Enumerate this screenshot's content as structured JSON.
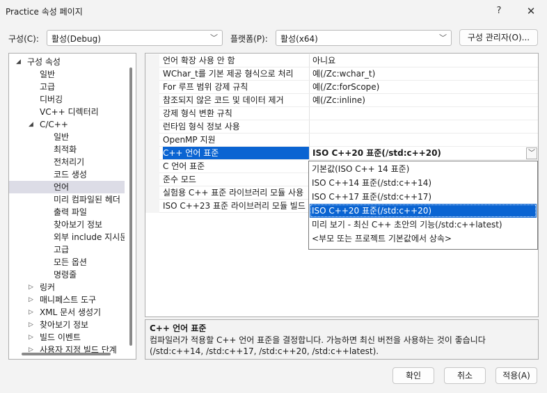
{
  "window": {
    "title": "Practice 속성 페이지",
    "help_label": "?",
    "close_label": "✕"
  },
  "config": {
    "configuration_label": "구성(C):",
    "configuration_value": "활성(Debug)",
    "platform_label": "플랫폼(P):",
    "platform_value": "활성(x64)",
    "manager_button": "구성 관리자(O)..."
  },
  "tree": {
    "items": [
      {
        "label": "구성 속성",
        "twisty": "◢"
      },
      {
        "label": "일반"
      },
      {
        "label": "고급"
      },
      {
        "label": "디버깅"
      },
      {
        "label": "VC++ 디렉터리"
      },
      {
        "label": "C/C++",
        "twisty": "◢"
      },
      {
        "label": "일반"
      },
      {
        "label": "최적화"
      },
      {
        "label": "전처리기"
      },
      {
        "label": "코드 생성"
      },
      {
        "label": "언어"
      },
      {
        "label": "미리 컴파일된 헤더"
      },
      {
        "label": "출력 파일"
      },
      {
        "label": "찾아보기 정보"
      },
      {
        "label": "외부 include 지시문"
      },
      {
        "label": "고급"
      },
      {
        "label": "모든 옵션"
      },
      {
        "label": "명령줄"
      },
      {
        "label": "링커",
        "twisty": "▷"
      },
      {
        "label": "매니페스트 도구",
        "twisty": "▷"
      },
      {
        "label": "XML 문서 생성기",
        "twisty": "▷"
      },
      {
        "label": "찾아보기 정보",
        "twisty": "▷"
      },
      {
        "label": "빌드 이벤트",
        "twisty": "▷"
      },
      {
        "label": "사용자 지정 빌드 단계",
        "twisty": "▷"
      }
    ]
  },
  "properties": {
    "rows": [
      {
        "name": "언어 확장 사용 안 함",
        "value": "아니요"
      },
      {
        "name": "WChar_t를 기본 제공 형식으로 처리",
        "value": "예(/Zc:wchar_t)"
      },
      {
        "name": "For 루프 범위 강제 규칙",
        "value": "예(/Zc:forScope)"
      },
      {
        "name": "참조되지 않은 코드 및 데이터 제거",
        "value": "예(/Zc:inline)"
      },
      {
        "name": "강제 형식 변환 규칙",
        "value": ""
      },
      {
        "name": "런타임 형식 정보 사용",
        "value": ""
      },
      {
        "name": "OpenMP 지원",
        "value": ""
      },
      {
        "name": "C++ 언어 표준",
        "value": "ISO C++20 표준(/std:c++20)"
      },
      {
        "name": "C 언어 표준",
        "value": ""
      },
      {
        "name": "준수 모드",
        "value": ""
      },
      {
        "name": "실험용 C++ 표준 라이브러리 모듈 사용",
        "value": ""
      },
      {
        "name": "ISO C++23 표준 라이브러리 모듈 빌드",
        "value": ""
      }
    ],
    "dropdown_icon": "chevron-down"
  },
  "dropdown": {
    "options": [
      "기본값(ISO C++ 14 표준)",
      "ISO C++14 표준(/std:c++14)",
      "ISO C++17 표준(/std:c++17)",
      "ISO C++20 표준(/std:c++20)",
      "미리 보기 - 최신 C++ 초안의 기능(/std:c++latest)",
      "<부모 또는 프로젝트 기본값에서 상속>"
    ],
    "selected_index": 3
  },
  "description": {
    "title": "C++ 언어 표준",
    "text": "컴파일러가 적용할 C++ 언어 표준을 결정합니다. 가능하면 최신 버전을 사용하는 것이 좋습니다 (/std:c++14, /std:c++17, /std:c++20, /std:c++latest)."
  },
  "buttons": {
    "ok": "확인",
    "cancel": "취소",
    "apply": "적용(A)"
  },
  "colors": {
    "selection": "#0a64d2",
    "tree_selection": "#dcdce6"
  }
}
